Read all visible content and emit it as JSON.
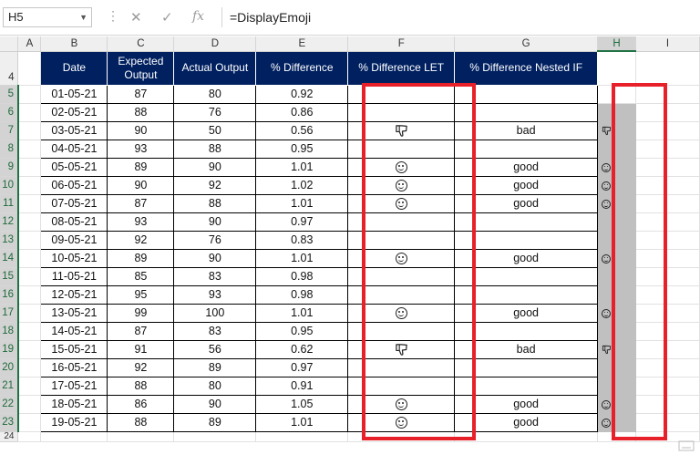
{
  "formula_bar": {
    "name_box": "H5",
    "formula": "=DisplayEmoji",
    "cancel_glyph": "✕",
    "enter_glyph": "✓",
    "fx_glyph": "fx"
  },
  "columns": [
    "A",
    "B",
    "C",
    "D",
    "E",
    "F",
    "G",
    "H",
    "I"
  ],
  "header": {
    "row_number": "4",
    "date": "Date",
    "expected": "Expected Output",
    "actual": "Actual Output",
    "pct": "% Difference",
    "pct_let": "% Difference LET",
    "pct_if": "% Difference Nested IF"
  },
  "rows": [
    {
      "r": "5",
      "date": "01-05-21",
      "exp": "87",
      "act": "80",
      "pct": "0.92",
      "emoji": "",
      "txt": ""
    },
    {
      "r": "6",
      "date": "02-05-21",
      "exp": "88",
      "act": "76",
      "pct": "0.86",
      "emoji": "",
      "txt": ""
    },
    {
      "r": "7",
      "date": "03-05-21",
      "exp": "90",
      "act": "50",
      "pct": "0.56",
      "emoji": "thumb",
      "txt": "bad"
    },
    {
      "r": "8",
      "date": "04-05-21",
      "exp": "93",
      "act": "88",
      "pct": "0.95",
      "emoji": "",
      "txt": ""
    },
    {
      "r": "9",
      "date": "05-05-21",
      "exp": "89",
      "act": "90",
      "pct": "1.01",
      "emoji": "smile",
      "txt": "good"
    },
    {
      "r": "10",
      "date": "06-05-21",
      "exp": "90",
      "act": "92",
      "pct": "1.02",
      "emoji": "smile",
      "txt": "good"
    },
    {
      "r": "11",
      "date": "07-05-21",
      "exp": "87",
      "act": "88",
      "pct": "1.01",
      "emoji": "smile",
      "txt": "good"
    },
    {
      "r": "12",
      "date": "08-05-21",
      "exp": "93",
      "act": "90",
      "pct": "0.97",
      "emoji": "",
      "txt": ""
    },
    {
      "r": "13",
      "date": "09-05-21",
      "exp": "92",
      "act": "76",
      "pct": "0.83",
      "emoji": "",
      "txt": ""
    },
    {
      "r": "14",
      "date": "10-05-21",
      "exp": "89",
      "act": "90",
      "pct": "1.01",
      "emoji": "smile",
      "txt": "good"
    },
    {
      "r": "15",
      "date": "11-05-21",
      "exp": "85",
      "act": "83",
      "pct": "0.98",
      "emoji": "",
      "txt": ""
    },
    {
      "r": "16",
      "date": "12-05-21",
      "exp": "95",
      "act": "93",
      "pct": "0.98",
      "emoji": "",
      "txt": ""
    },
    {
      "r": "17",
      "date": "13-05-21",
      "exp": "99",
      "act": "100",
      "pct": "1.01",
      "emoji": "smile",
      "txt": "good"
    },
    {
      "r": "18",
      "date": "14-05-21",
      "exp": "87",
      "act": "83",
      "pct": "0.95",
      "emoji": "",
      "txt": ""
    },
    {
      "r": "19",
      "date": "15-05-21",
      "exp": "91",
      "act": "56",
      "pct": "0.62",
      "emoji": "thumb",
      "txt": "bad"
    },
    {
      "r": "20",
      "date": "16-05-21",
      "exp": "92",
      "act": "89",
      "pct": "0.97",
      "emoji": "",
      "txt": ""
    },
    {
      "r": "21",
      "date": "17-05-21",
      "exp": "88",
      "act": "80",
      "pct": "0.91",
      "emoji": "",
      "txt": ""
    },
    {
      "r": "22",
      "date": "18-05-21",
      "exp": "86",
      "act": "90",
      "pct": "1.05",
      "emoji": "smile",
      "txt": "good"
    },
    {
      "r": "23",
      "date": "19-05-21",
      "exp": "88",
      "act": "89",
      "pct": "1.01",
      "emoji": "smile",
      "txt": "good"
    }
  ],
  "last_row_number": "24",
  "colors": {
    "header_fill": "#002060",
    "highlight_border": "#e8202a",
    "selection_fill": "#c0c0c0",
    "excel_green": "#217346"
  },
  "icons": {
    "smile": "smiling-face-icon",
    "thumb": "thumbs-down-icon"
  }
}
